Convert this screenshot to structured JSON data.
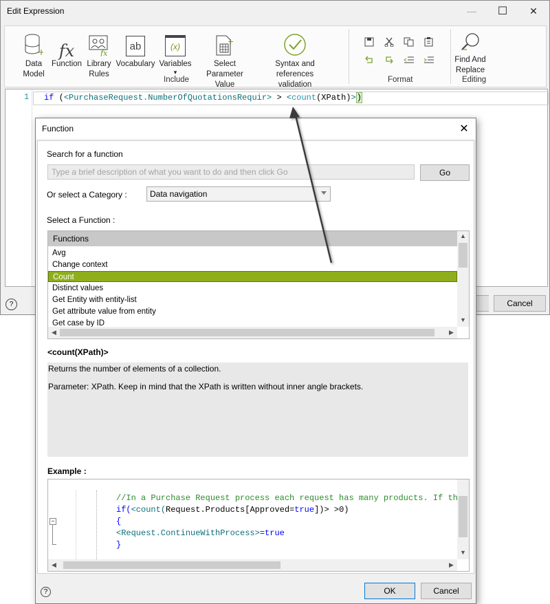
{
  "edit_window": {
    "title": "Edit Expression",
    "minimize_glyph": "—",
    "maximize_glyph": "☐",
    "close_glyph": "✕",
    "help_glyph": "?",
    "cancel_label": "Cancel"
  },
  "ribbon": {
    "items": [
      {
        "label_line1": "Data",
        "label_line2": "Model",
        "icon": "database-icon"
      },
      {
        "label_line1": "Function",
        "label_line2": "",
        "icon": "fx-icon"
      },
      {
        "label_line1": "Library",
        "label_line2": "Rules",
        "icon": "library-rules-icon"
      },
      {
        "label_line1": "Vocabulary",
        "label_line2": "",
        "icon": "vocabulary-icon"
      },
      {
        "label_line1": "Variables",
        "label_line2": "▾",
        "icon": "variables-icon"
      },
      {
        "label_line1": "Select Parameter",
        "label_line2": "Value",
        "icon": "select-parameter-icon"
      },
      {
        "label_line1": "Syntax and references",
        "label_line2": "validation",
        "icon": "validation-check-icon"
      },
      {
        "label_line1": "Find And",
        "label_line2": "Replace",
        "icon": "find-replace-icon"
      }
    ],
    "groups": {
      "include": "Include",
      "format": "Format",
      "editing": "Editing"
    },
    "fx_glyph": "fx",
    "ab_glyph": "ab",
    "x_glyph": "(x)"
  },
  "editor": {
    "line_number": "1",
    "code": {
      "kw_if": "if",
      "open": " (",
      "t1": "<PurchaseRequest.NumberOfQuotationsRequir>",
      "gt": " > ",
      "t2_open": "<",
      "fn": "count",
      "t2_args": "(XPath)",
      "t2_close": ">",
      "close": ")"
    }
  },
  "function_dialog": {
    "title": "Function",
    "close_glyph": "✕",
    "search_label": "Search for a function",
    "search_placeholder": "Type a brief description of what you want to do and then click Go",
    "go_label": "Go",
    "category_label": "Or select a Category :",
    "category_value": "Data navigation",
    "select_function_label": "Select a Function :",
    "list_header": "Functions",
    "functions": [
      "Avg",
      "Change context",
      "Count",
      "Distinct values",
      "Get Entity with entity-list",
      "Get attribute value from entity",
      "Get case by ID"
    ],
    "selected_index": 2,
    "signature": "<count(XPath)>",
    "description_line1": "Returns the number of elements of a collection.",
    "description_line2": "Parameter: XPath. Keep in mind that the XPath is written without inner angle brackets.",
    "example_label": "Example :",
    "example": {
      "comment": "//In a Purchase Request process each request has many products. If ther",
      "line2_if": "if(",
      "line2_fn_open": "<count(",
      "line2_path": "Request.Products[Approved=",
      "line2_true": "true",
      "line2_rest": "])> >0)",
      "line3": "{",
      "line4_tok": "<Request.ContinueWithProcess>",
      "line4_eq": "=",
      "line4_true": "true",
      "line5": "}"
    },
    "help_glyph": "?",
    "ok_label": "OK",
    "cancel_label": "Cancel"
  }
}
